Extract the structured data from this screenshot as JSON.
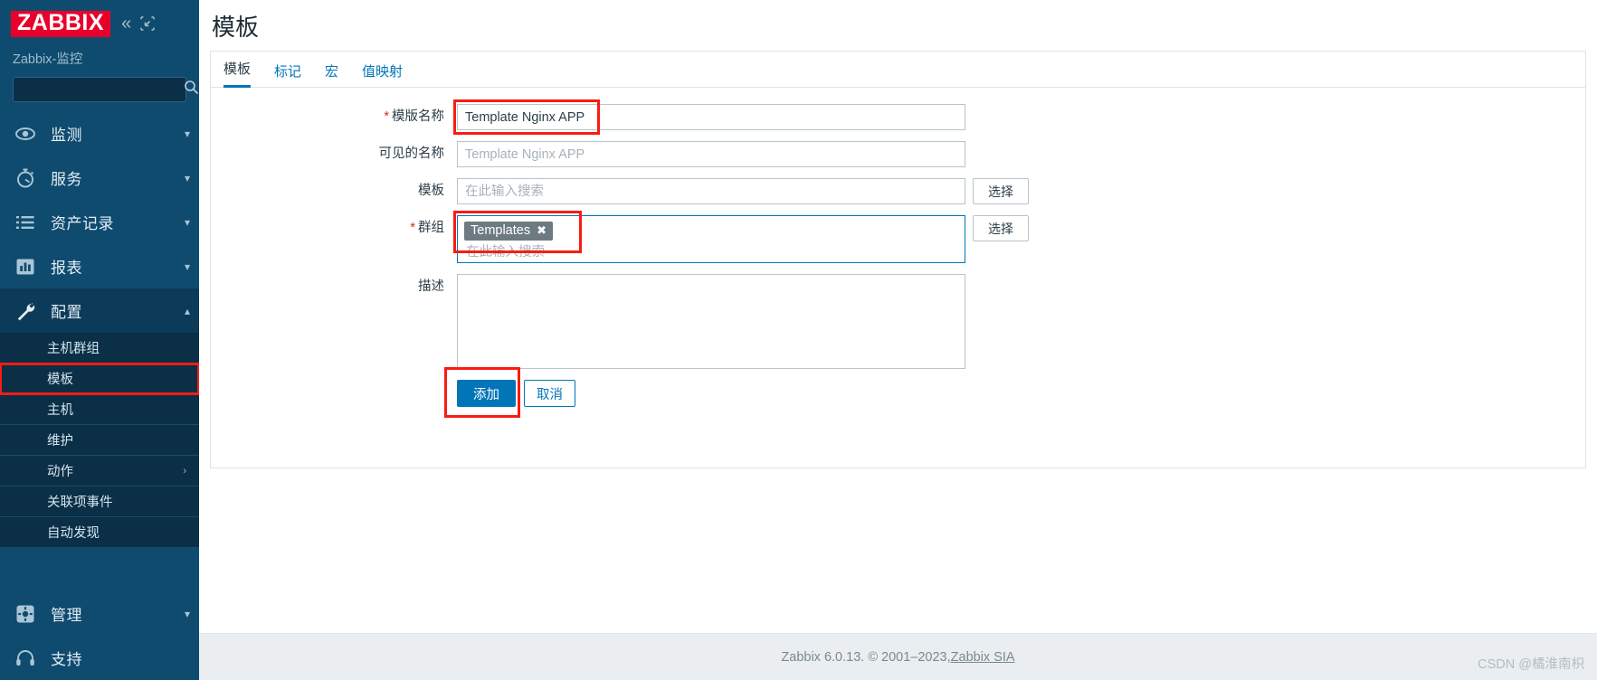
{
  "sidebar": {
    "logo_text": "ZABBIX",
    "collapse_icon": "double-chevron-left-icon",
    "expand_icon": "collapse-panel-icon",
    "server_name": "Zabbix-监控",
    "search_placeholder": "",
    "search_value": "",
    "nav": [
      {
        "label": "监测",
        "icon": "eye-icon",
        "arrow": "chevron-down",
        "expanded": false
      },
      {
        "label": "服务",
        "icon": "stopwatch-icon",
        "arrow": "chevron-down",
        "expanded": false
      },
      {
        "label": "资产记录",
        "icon": "list-icon",
        "arrow": "chevron-down",
        "expanded": false
      },
      {
        "label": "报表",
        "icon": "chart-bar-icon",
        "arrow": "chevron-down",
        "expanded": false
      },
      {
        "label": "配置",
        "icon": "wrench-icon",
        "arrow": "chevron-up",
        "expanded": true
      }
    ],
    "sub_items": [
      {
        "label": "主机群组",
        "arrow": "",
        "highlighted": false
      },
      {
        "label": "模板",
        "arrow": "",
        "highlighted": true
      },
      {
        "label": "主机",
        "arrow": "",
        "highlighted": false
      },
      {
        "label": "维护",
        "arrow": "",
        "highlighted": false
      },
      {
        "label": "动作",
        "arrow": "›",
        "highlighted": false
      },
      {
        "label": "关联项事件",
        "arrow": "",
        "highlighted": false
      },
      {
        "label": "自动发现",
        "arrow": "",
        "highlighted": false
      }
    ],
    "bottom_nav": [
      {
        "label": "管理",
        "icon": "gear-icon",
        "arrow": "chevron-down"
      },
      {
        "label": "支持",
        "icon": "headset-icon",
        "arrow": ""
      }
    ]
  },
  "page": {
    "title": "模板"
  },
  "tabs": [
    {
      "label": "模板",
      "active": true
    },
    {
      "label": "标记",
      "active": false
    },
    {
      "label": "宏",
      "active": false
    },
    {
      "label": "值映射",
      "active": false
    }
  ],
  "form": {
    "template_name": {
      "label": "模版名称",
      "required": true,
      "value": "Template Nginx APP",
      "placeholder": ""
    },
    "visible_name": {
      "label": "可见的名称",
      "required": false,
      "value": "",
      "placeholder": "Template Nginx APP"
    },
    "templates": {
      "label": "模板",
      "required": false,
      "value": "",
      "placeholder": "在此输入搜索",
      "select_button": "选择"
    },
    "groups": {
      "label": "群组",
      "required": true,
      "chips": [
        {
          "text": "Templates",
          "remove_icon": "close-icon"
        }
      ],
      "placeholder": "在此输入搜索",
      "select_button": "选择"
    },
    "description": {
      "label": "描述",
      "required": false,
      "value": "",
      "placeholder": ""
    },
    "submit_label": "添加",
    "cancel_label": "取消"
  },
  "footer": {
    "text": "Zabbix 6.0.13. © 2001–2023, ",
    "link": "Zabbix SIA",
    "watermark": "CSDN @橘淮南枳"
  },
  "colors": {
    "sidebar_bg": "#0f4b6e",
    "sidebar_sub_bg": "#0a2f47",
    "logo_red": "#e8002b",
    "accent_blue": "#0275b8",
    "annotation_red": "#f81c12",
    "chip_grey": "#6d7a82",
    "footer_bg": "#eaeef0"
  }
}
